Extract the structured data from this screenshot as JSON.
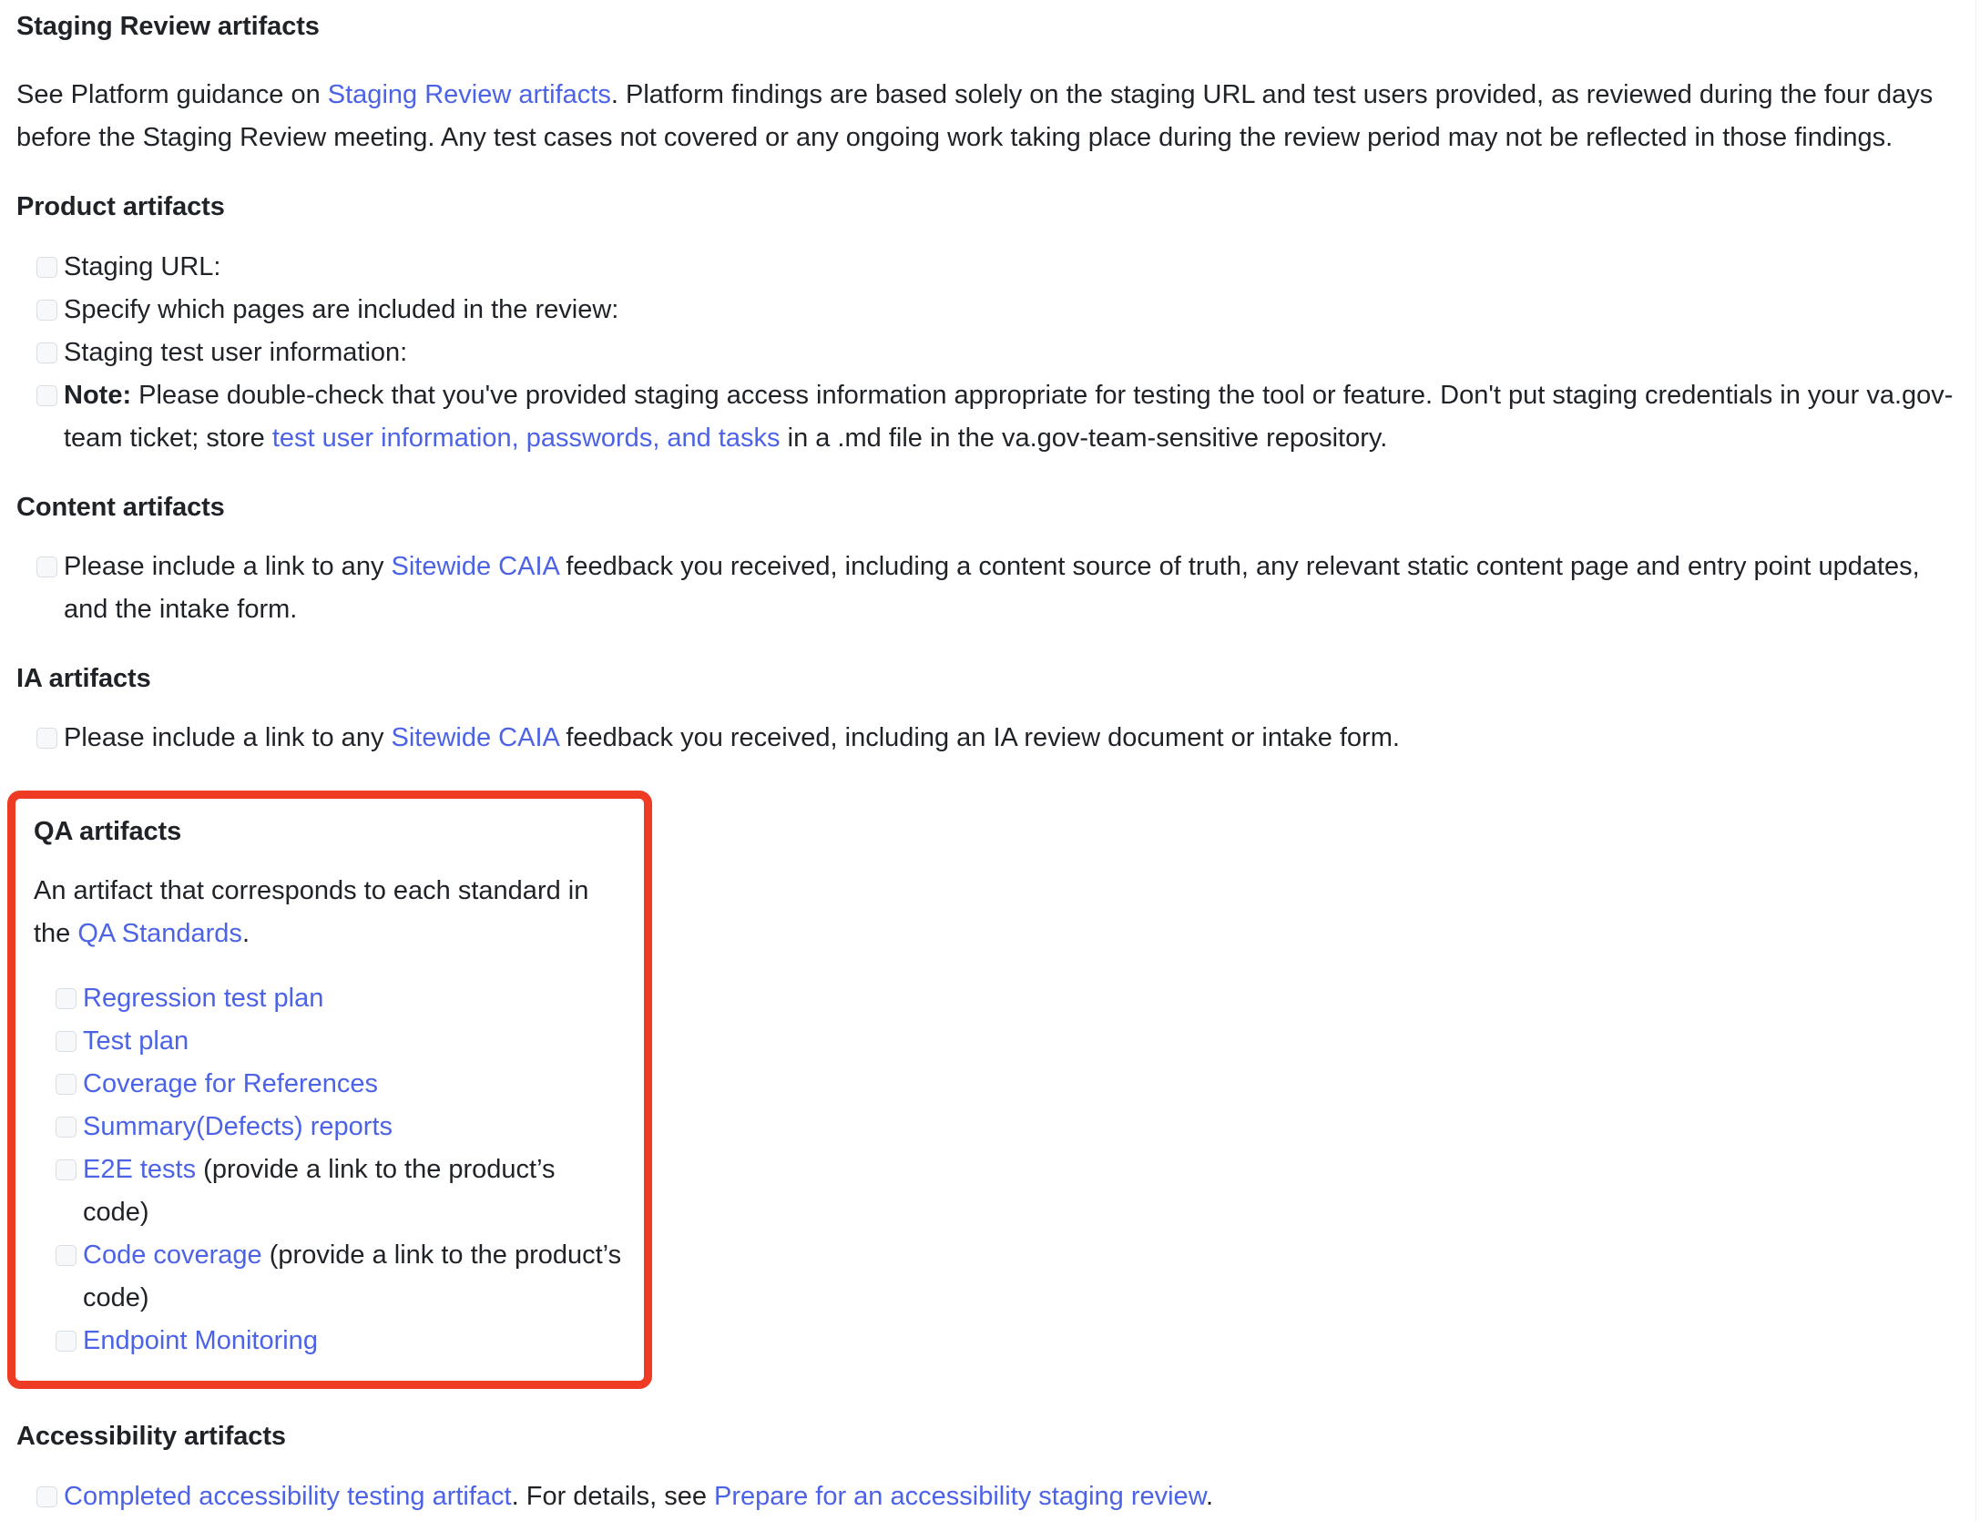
{
  "document": {
    "heading": "Staging Review artifacts",
    "intro": {
      "before_link": "See Platform guidance on ",
      "link_text": "Staging Review artifacts",
      "after_link": ". Platform findings are based solely on the staging URL and test users provided, as reviewed during the four days before the Staging Review meeting. Any test cases not covered or any ongoing work taking place during the review period may not be reflected in those findings."
    }
  },
  "product_artifacts": {
    "heading": "Product artifacts",
    "items": [
      {
        "text": "Staging URL:"
      },
      {
        "text": "Specify which pages are included in the review:"
      },
      {
        "text": "Staging test user information:"
      }
    ],
    "note": {
      "label": "Note:",
      "before_link": " Please double-check that you've provided staging access information appropriate for testing the tool or feature. Don't put staging credentials in your va.gov-team ticket; store ",
      "link_text": "test user information, passwords, and tasks",
      "after_link": " in a .md file in the va.gov-team-sensitive repository."
    }
  },
  "content_artifacts": {
    "heading": "Content artifacts",
    "item": {
      "before_link": "Please include a link to any ",
      "link_text": "Sitewide CAIA",
      "after_link": " feedback you received, including a content source of truth, any relevant static content page and entry point updates, and the intake form."
    }
  },
  "ia_artifacts": {
    "heading": "IA artifacts",
    "item": {
      "before_link": "Please include a link to any ",
      "link_text": "Sitewide CAIA",
      "after_link": " feedback you received, including an IA review document or intake form."
    }
  },
  "qa_artifacts": {
    "heading": "QA artifacts",
    "highlight_color": "#ee3b24",
    "description": {
      "before_link": "An artifact that corresponds to each standard in the ",
      "link_text": "QA Standards",
      "after_link": "."
    },
    "items": [
      {
        "link_text": "Regression test plan",
        "suffix": ""
      },
      {
        "link_text": "Test plan",
        "suffix": ""
      },
      {
        "link_text": "Coverage for References",
        "suffix": ""
      },
      {
        "link_text": "Summary(Defects) reports",
        "suffix": ""
      },
      {
        "link_text": "E2E tests",
        "suffix": " (provide a link to the product’s code)"
      },
      {
        "link_text": "Code coverage",
        "suffix": " (provide a link to the product’s code)"
      },
      {
        "link_text": "Endpoint Monitoring",
        "suffix": ""
      }
    ]
  },
  "accessibility_artifacts": {
    "heading": "Accessibility artifacts",
    "item": {
      "link_text": "Completed accessibility testing artifact",
      "middle_text": ". For details, see ",
      "link_text_2": "Prepare for an accessibility staging review",
      "after_text": "."
    }
  },
  "colors": {
    "link": "#4c63e6",
    "text": "#1f2328",
    "highlight": "#ee3b24",
    "checkbox_border": "#d8dee4",
    "checkbox_fill": "#f6f8fa"
  }
}
